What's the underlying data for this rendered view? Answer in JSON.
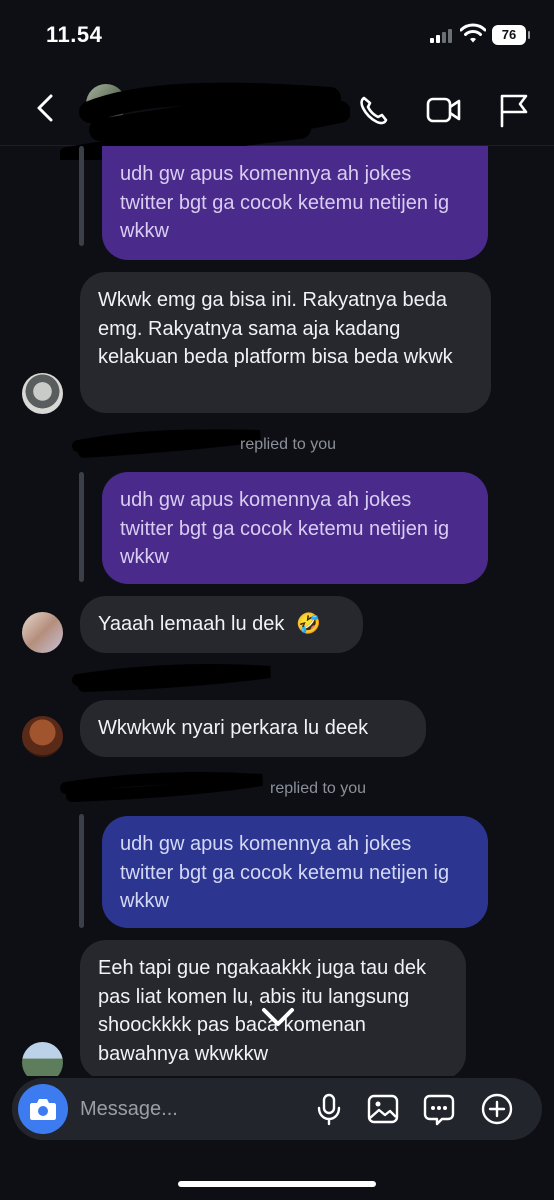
{
  "status_bar": {
    "time": "11.54",
    "battery": "76"
  },
  "header": {
    "icons": [
      "back-arrow-icon",
      "phone-icon",
      "video-icon",
      "flag-icon"
    ]
  },
  "messages": {
    "q1": "udh gw apus komennya ah jokes twitter bgt ga cocok ketemu netijen ig wkkw",
    "m1": "Wkwk emg ga bisa ini. Rakyatnya beda emg. Rakyatnya sama aja kadang kelakuan beda platform bisa beda wkwk",
    "reply_label_1": "replied to you",
    "q2": "udh gw apus komennya ah jokes twitter bgt ga cocok ketemu netijen ig wkkw",
    "m2": "Yaaah lemaah lu dek",
    "m2_emoji": "🤣",
    "m3": "Wkwkwk nyari perkara lu deek",
    "reply_label_2": "replied to you",
    "q3": "udh gw apus komennya ah jokes twitter bgt ga cocok ketemu netijen ig wkkw",
    "m4": "Eeh tapi gue ngakaakkk juga tau dek pas liat komen lu, abis itu langsung shoockkkk pas baca komenan bawahnya wkwkkw"
  },
  "composer": {
    "placeholder": "Message...",
    "icons": [
      "camera-icon",
      "microphone-icon",
      "image-icon",
      "sticker-icon",
      "plus-icon"
    ]
  },
  "colors": {
    "background": "#0d0f14",
    "quoted_purple": "#4a2a8a",
    "quoted_blue": "#2c3590",
    "incoming_bubble": "#26282e",
    "camera_blue": "#3d7bf0"
  }
}
